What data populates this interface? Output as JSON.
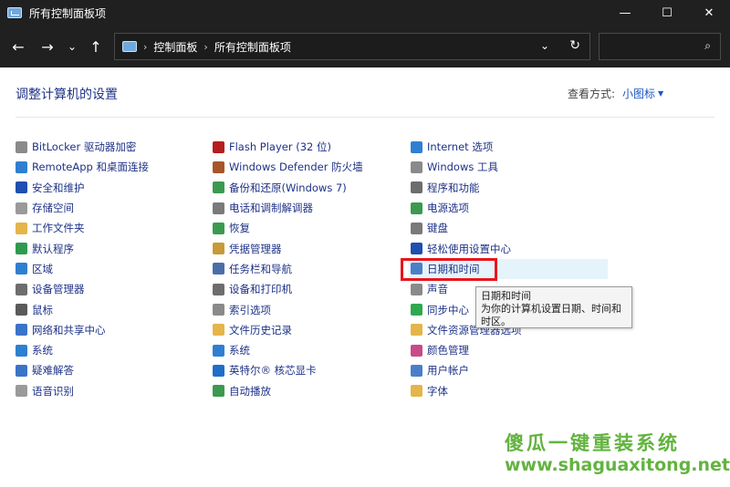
{
  "window": {
    "title": "所有控制面板项",
    "minimize_glyph": "—",
    "maximize_glyph": "☐",
    "close_glyph": "✕"
  },
  "nav": {
    "back_glyph": "←",
    "forward_glyph": "→",
    "recent_glyph": "⌄",
    "up_glyph": "↑"
  },
  "address": {
    "crumbs": [
      "控制面板",
      "所有控制面板项"
    ],
    "separator": "›",
    "dropdown_glyph": "⌄",
    "refresh_glyph": "↻"
  },
  "search": {
    "placeholder": "",
    "icon_glyph": "⌕"
  },
  "header": {
    "title": "调整计算机的设置",
    "view_label": "查看方式:",
    "view_value": "小图标",
    "view_caret": "▼"
  },
  "columns": [
    [
      {
        "label": "BitLocker 驱动器加密",
        "icon": "bitlocker-icon",
        "color": "#8a8a8a"
      },
      {
        "label": "RemoteApp 和桌面连接",
        "icon": "remoteapp-icon",
        "color": "#2f7fd1"
      },
      {
        "label": "安全和维护",
        "icon": "security-flag-icon",
        "color": "#1f4fb0"
      },
      {
        "label": "存储空间",
        "icon": "storage-icon",
        "color": "#9a9a9a"
      },
      {
        "label": "工作文件夹",
        "icon": "work-folder-icon",
        "color": "#e3b54a"
      },
      {
        "label": "默认程序",
        "icon": "default-programs-icon",
        "color": "#2f9a4f"
      },
      {
        "label": "区域",
        "icon": "region-icon",
        "color": "#2f7fd1"
      },
      {
        "label": "设备管理器",
        "icon": "device-manager-icon",
        "color": "#6d6d6d"
      },
      {
        "label": "鼠标",
        "icon": "mouse-icon",
        "color": "#5a5a5a"
      },
      {
        "label": "网络和共享中心",
        "icon": "network-icon",
        "color": "#3a74c8"
      },
      {
        "label": "系统",
        "icon": "system-icon",
        "color": "#2f7fd1"
      },
      {
        "label": "疑难解答",
        "icon": "troubleshoot-icon",
        "color": "#3a74c8"
      },
      {
        "label": "语音识别",
        "icon": "microphone-icon",
        "color": "#9a9a9a"
      }
    ],
    [
      {
        "label": "Flash Player (32 位)",
        "icon": "flash-icon",
        "color": "#b81d1d"
      },
      {
        "label": "Windows Defender 防火墙",
        "icon": "firewall-icon",
        "color": "#a8552a"
      },
      {
        "label": "备份和还原(Windows 7)",
        "icon": "backup-icon",
        "color": "#3a9a4f"
      },
      {
        "label": "电话和调制解调器",
        "icon": "phone-icon",
        "color": "#7a7a7a"
      },
      {
        "label": "恢复",
        "icon": "recovery-icon",
        "color": "#3a9a4f"
      },
      {
        "label": "凭据管理器",
        "icon": "credential-icon",
        "color": "#c79a3a"
      },
      {
        "label": "任务栏和导航",
        "icon": "taskbar-icon",
        "color": "#4a6ea8"
      },
      {
        "label": "设备和打印机",
        "icon": "printer-icon",
        "color": "#6d6d6d"
      },
      {
        "label": "索引选项",
        "icon": "indexing-icon",
        "color": "#8a8a8a"
      },
      {
        "label": "文件历史记录",
        "icon": "file-history-icon",
        "color": "#e3b54a"
      },
      {
        "label": "系统",
        "icon": "system-icon",
        "color": "#2f7fd1"
      },
      {
        "label": "英特尔® 核芯显卡",
        "icon": "intel-graphics-icon",
        "color": "#1f6fc8"
      },
      {
        "label": "自动播放",
        "icon": "autoplay-icon",
        "color": "#3a9a4f"
      }
    ],
    [
      {
        "label": "Internet 选项",
        "icon": "internet-icon",
        "color": "#2f7fd1"
      },
      {
        "label": "Windows 工具",
        "icon": "windows-tools-icon",
        "color": "#8a8a8a"
      },
      {
        "label": "程序和功能",
        "icon": "programs-icon",
        "color": "#6d6d6d"
      },
      {
        "label": "电源选项",
        "icon": "power-icon",
        "color": "#3a9a4f"
      },
      {
        "label": "键盘",
        "icon": "keyboard-icon",
        "color": "#7a7a7a"
      },
      {
        "label": "轻松使用设置中心",
        "icon": "ease-of-access-icon",
        "color": "#1f4fb0"
      },
      {
        "label": "日期和时间",
        "icon": "clock-icon",
        "color": "#4a7fc8"
      },
      {
        "label": "声音",
        "icon": "speaker-icon",
        "color": "#8a8a8a"
      },
      {
        "label": "同步中心",
        "icon": "sync-icon",
        "color": "#2fa84f"
      },
      {
        "label": "文件资源管理器选项",
        "icon": "folder-options-icon",
        "color": "#e3b54a"
      },
      {
        "label": "颜色管理",
        "icon": "color-management-icon",
        "color": "#c84a8a"
      },
      {
        "label": "用户帐户",
        "icon": "user-accounts-icon",
        "color": "#4a7fc8"
      },
      {
        "label": "字体",
        "icon": "fonts-icon",
        "color": "#e3b54a"
      }
    ]
  ],
  "tooltip": {
    "title": "日期和时间",
    "text": "为你的计算机设置日期、时间和时区。"
  },
  "watermark": {
    "line1": "傻瓜一键重装系统",
    "line2": "www.shaguaxitong.net"
  }
}
